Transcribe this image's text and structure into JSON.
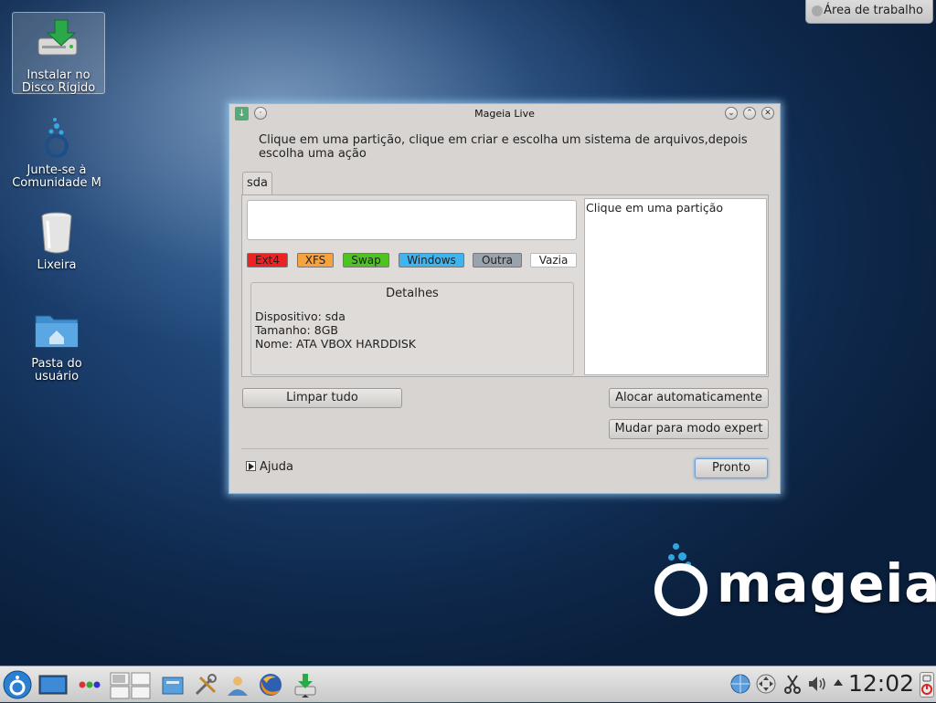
{
  "desktop": {
    "icons": [
      {
        "label_line1": "Instalar no",
        "label_line2": "Disco Rígido"
      },
      {
        "label_line1": "Junte-se à",
        "label_line2": "Comunidade M"
      },
      {
        "label_line1": "Lixeira",
        "label_line2": ""
      },
      {
        "label_line1": "Pasta do",
        "label_line2": "usuário"
      }
    ],
    "workspace_label": "Área de trabalho",
    "logo_text": "mageia"
  },
  "window": {
    "title": "Mageia Live",
    "instruction": "Clique em uma partição, clique em criar e escolha um sistema de arquivos,depois escolha uma ação",
    "tab_label": "sda",
    "legend": [
      {
        "label": "Ext4",
        "color": "#ee2222"
      },
      {
        "label": "XFS",
        "color": "#f7a23c"
      },
      {
        "label": "Swap",
        "color": "#4fc322"
      },
      {
        "label": "Windows",
        "color": "#3fb4ee"
      },
      {
        "label": "Outra",
        "color": "#9aa3ad"
      },
      {
        "label": "Vazia",
        "color": "#ffffff"
      }
    ],
    "details": {
      "title": "Detalhes",
      "device": "Dispositivo: sda",
      "size": "Tamanho: 8GB",
      "name": "Nome: ATA VBOX HARDDISK"
    },
    "info_text": "Clique em uma partição",
    "buttons": {
      "clear_all": "Limpar tudo",
      "auto_allocate": "Alocar automaticamente",
      "expert_mode": "Mudar para modo expert",
      "done": "Pronto"
    },
    "help_label": "Ajuda"
  },
  "taskbar": {
    "clock": "12:02",
    "icons": [
      "mageia-menu-icon",
      "desktop-icon",
      "activity-dots-icon",
      "pager-icon",
      "file-manager-icon",
      "tools-icon",
      "network-install-icon",
      "firefox-icon",
      "installer-icon"
    ],
    "tray_icons": [
      "network-globe-icon",
      "move-icon",
      "clipboard-scissors-icon",
      "volume-icon",
      "tray-expand-icon",
      "power-icon"
    ]
  }
}
